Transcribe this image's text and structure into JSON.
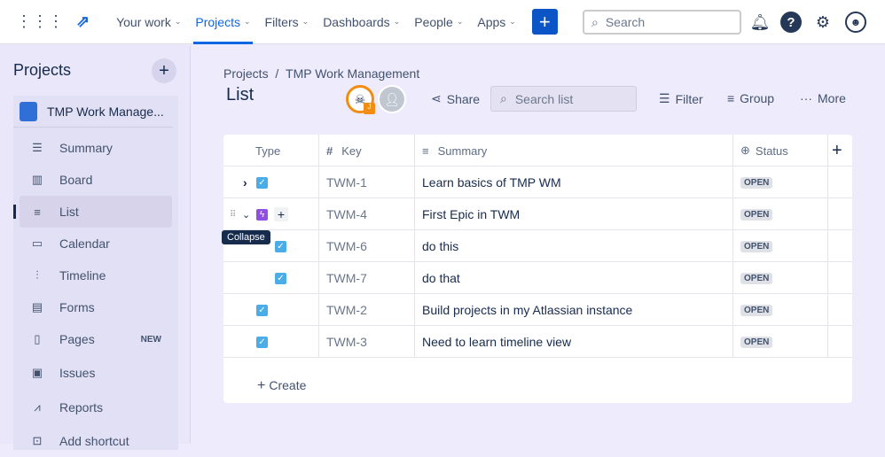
{
  "nav": {
    "items": [
      {
        "label": "Your work"
      },
      {
        "label": "Projects"
      },
      {
        "label": "Filters"
      },
      {
        "label": "Dashboards"
      },
      {
        "label": "People"
      },
      {
        "label": "Apps"
      }
    ],
    "create": "+",
    "search_placeholder": "Search"
  },
  "sidebar": {
    "title": "Projects",
    "add": "+",
    "project_name": "TMP Work Manage...",
    "items": [
      {
        "label": "Summary"
      },
      {
        "label": "Board"
      },
      {
        "label": "List"
      },
      {
        "label": "Calendar"
      },
      {
        "label": "Timeline"
      },
      {
        "label": "Forms"
      },
      {
        "label": "Pages",
        "badge": "NEW"
      },
      {
        "label": "Issues"
      },
      {
        "label": "Reports"
      },
      {
        "label": "Add shortcut"
      }
    ]
  },
  "breadcrumb": {
    "root": "Projects",
    "sep": "/",
    "project": "TMP Work Management"
  },
  "page_title": "List",
  "toolbar": {
    "avatar_badge": "J",
    "share": "Share",
    "search_placeholder": "Search list",
    "filter": "Filter",
    "group": "Group",
    "more": "More"
  },
  "table": {
    "headers": {
      "type": "Type",
      "key": "Key",
      "summary": "Summary",
      "status": "Status",
      "add": "+"
    },
    "rows": [
      {
        "key": "TWM-1",
        "summary": "Learn basics of TMP WM",
        "status": "OPEN"
      },
      {
        "key": "TWM-4",
        "summary": "First Epic in TWM",
        "status": "OPEN"
      },
      {
        "key": "TWM-6",
        "summary": "do this",
        "status": "OPEN"
      },
      {
        "key": "TWM-7",
        "summary": "do that",
        "status": "OPEN"
      },
      {
        "key": "TWM-2",
        "summary": "Build projects in my Atlassian instance",
        "status": "OPEN"
      },
      {
        "key": "TWM-3",
        "summary": "Need to learn timeline view",
        "status": "OPEN"
      }
    ],
    "create": "Create"
  },
  "tooltip": "Collapse",
  "colors": {
    "accent": "#0c66e4",
    "epic": "#904ee2",
    "task": "#4bade8"
  }
}
